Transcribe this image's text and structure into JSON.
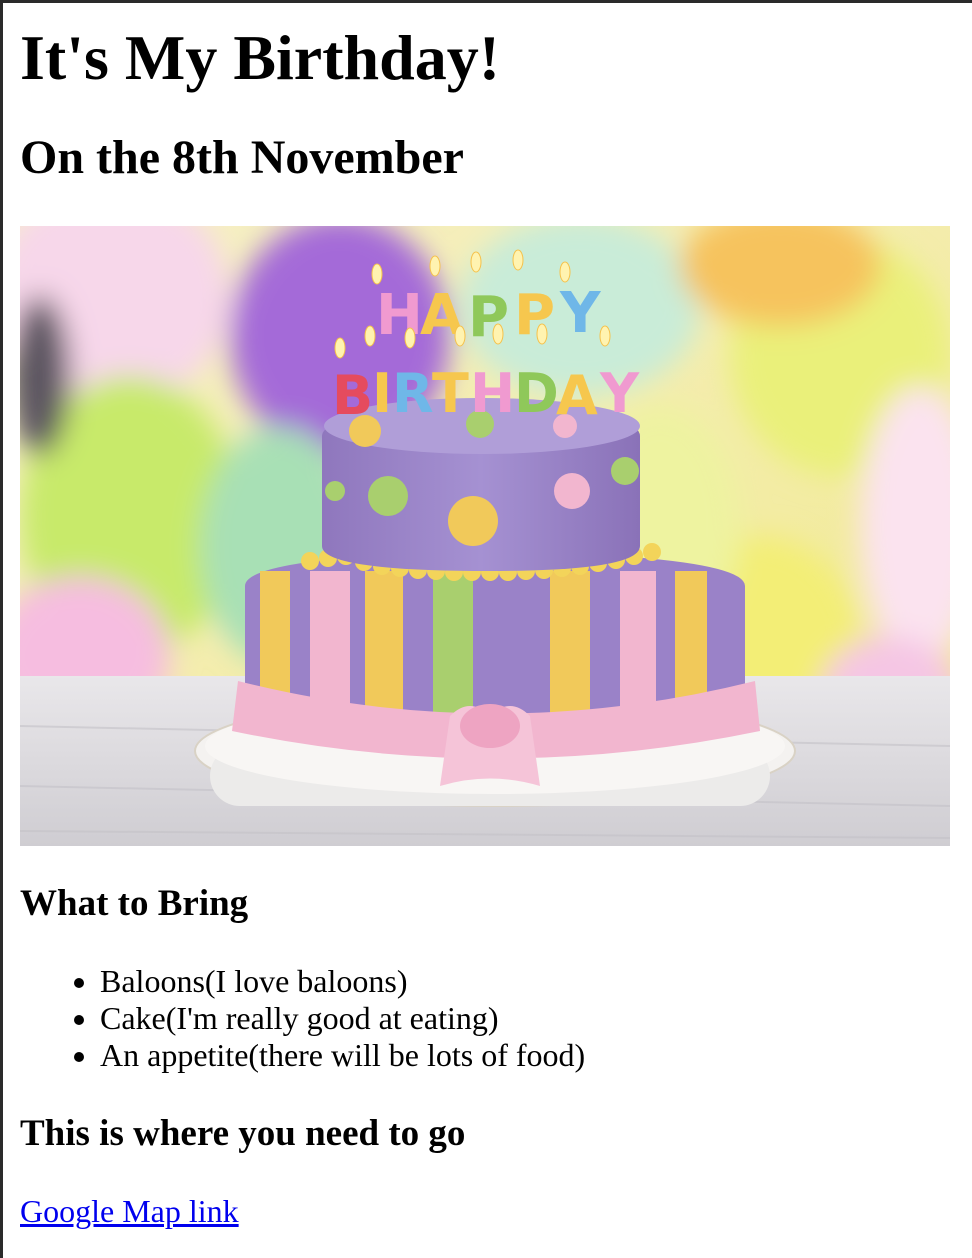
{
  "page": {
    "title": "It's My Birthday!",
    "date_heading": "On the 8th November",
    "bring_heading": "What to Bring",
    "bring_items": [
      {
        "text": "Baloons(I love baloons)"
      },
      {
        "text": "Cake(I'm really good at eating)"
      },
      {
        "text": "An appetite(there will be lots of food)"
      }
    ],
    "where_heading": "This is where you need to go",
    "map_link_label": "Google Map link"
  },
  "image": {
    "candle_letters_top": "HAPPY",
    "candle_letters_bottom": "BIRTHDAY",
    "colors": {
      "background": "#f4eaa0",
      "cake_purple": "#9a82c8",
      "ribbon_pink": "#f2b6cf",
      "stripe_yellow": "#f1c95a",
      "stripe_green": "#a9cf6e",
      "balloon_purple": "#a46ad8",
      "balloon_green": "#c8ea6a",
      "balloon_yellow": "#f3ee76"
    }
  }
}
